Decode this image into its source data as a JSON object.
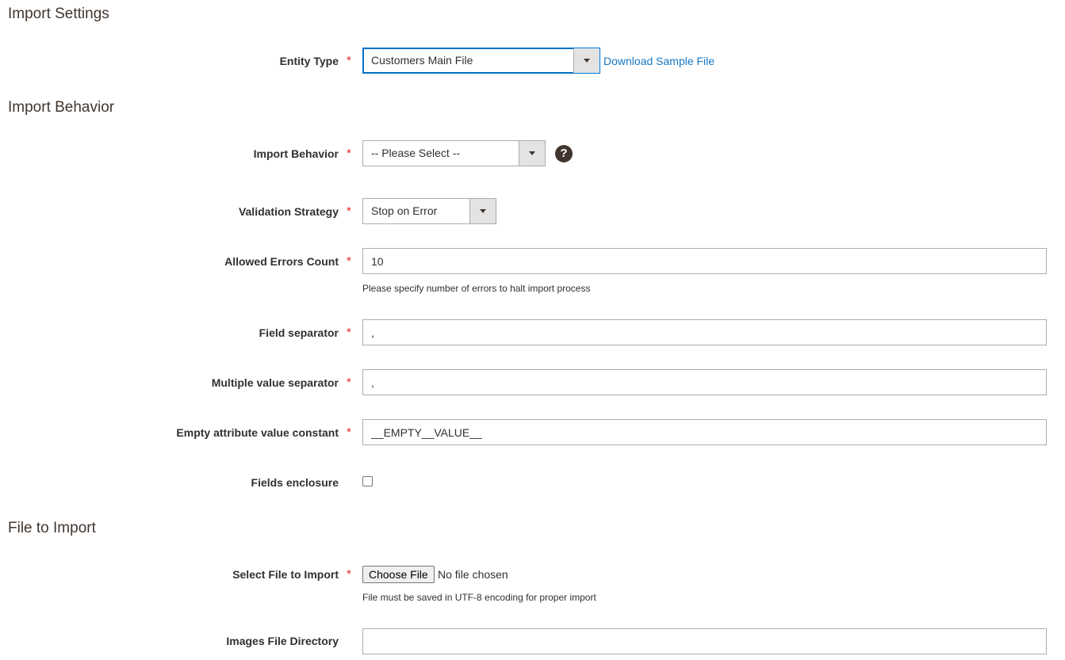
{
  "sections": {
    "import_settings": "Import Settings",
    "import_behavior": "Import Behavior",
    "file_to_import": "File to Import"
  },
  "required_marker": "*",
  "entity_type": {
    "label": "Entity Type",
    "value": "Customers Main File",
    "sample_link": "Download Sample File"
  },
  "import_behavior": {
    "label": "Import Behavior",
    "value": "-- Please Select --",
    "help_icon_glyph": "?"
  },
  "validation_strategy": {
    "label": "Validation Strategy",
    "value": "Stop on Error"
  },
  "allowed_errors": {
    "label": "Allowed Errors Count",
    "value": "10",
    "note": "Please specify number of errors to halt import process"
  },
  "field_separator": {
    "label": "Field separator",
    "value": ","
  },
  "multiple_value_separator": {
    "label": "Multiple value separator",
    "value": ","
  },
  "empty_attribute": {
    "label": "Empty attribute value constant",
    "value": "__EMPTY__VALUE__"
  },
  "fields_enclosure": {
    "label": "Fields enclosure",
    "checked": false
  },
  "select_file": {
    "label": "Select File to Import",
    "button": "Choose File",
    "status": "No file chosen",
    "note": "File must be saved in UTF-8 encoding for proper import"
  },
  "images_dir": {
    "label": "Images File Directory",
    "value": ""
  },
  "icons": {
    "dropdown": "chevron-down-icon",
    "help": "help-icon"
  },
  "colors": {
    "required": "#e22626",
    "link": "#1979c3",
    "focus": "#007bdb",
    "heading": "#41362f"
  }
}
